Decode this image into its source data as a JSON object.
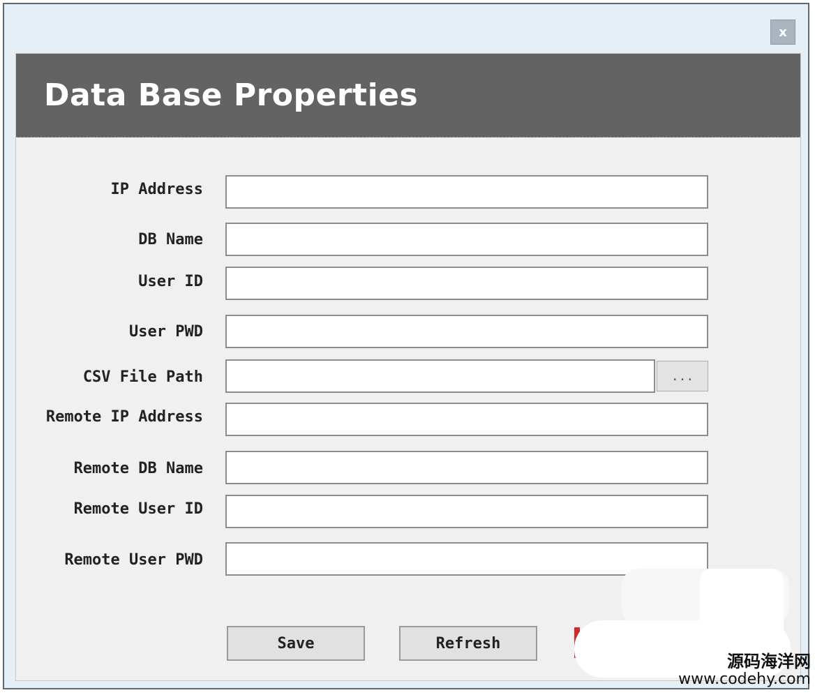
{
  "window": {
    "close_label": "x"
  },
  "header": {
    "title": "Data Base Properties"
  },
  "fields": [
    {
      "label": "IP Address",
      "value": ""
    },
    {
      "label": "DB Name",
      "value": ""
    },
    {
      "label": "User ID",
      "value": ""
    },
    {
      "label": "User PWD",
      "value": ""
    },
    {
      "label": "CSV File Path",
      "value": "",
      "browse_label": "..."
    },
    {
      "label": "Remote IP Address",
      "value": ""
    },
    {
      "label": "Remote DB Name",
      "value": ""
    },
    {
      "label": "Remote User ID",
      "value": ""
    },
    {
      "label": "Remote User PWD",
      "value": ""
    }
  ],
  "buttons": {
    "save": "Save",
    "refresh": "Refresh"
  },
  "watermark": {
    "cn": "源码海洋网",
    "url": "www.codehy.com"
  }
}
